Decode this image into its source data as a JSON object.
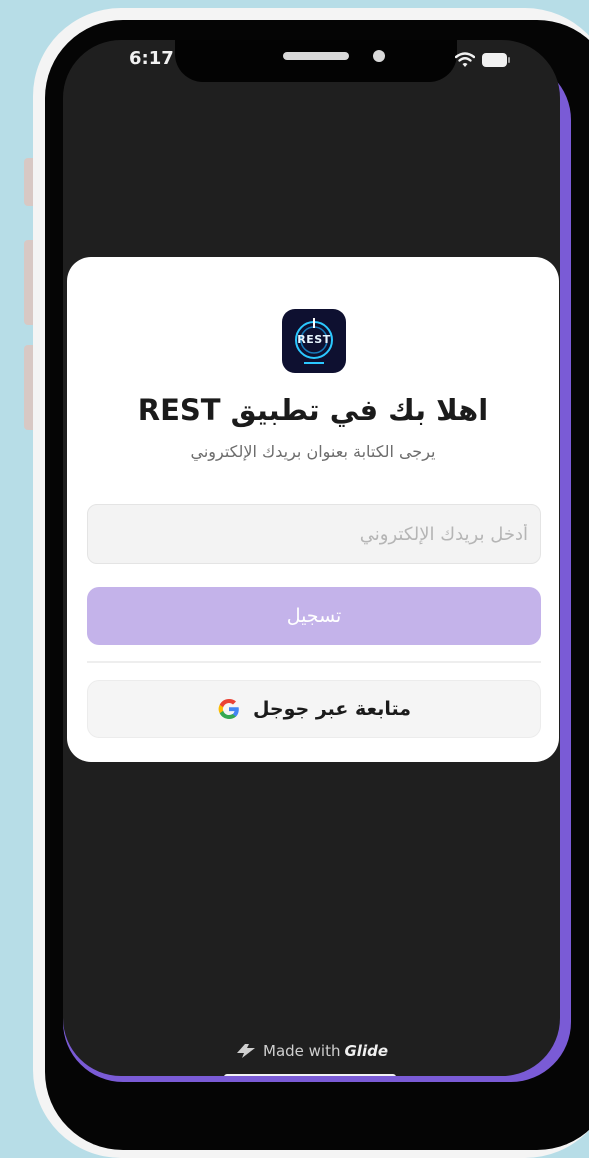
{
  "status_bar": {
    "time": "6:17"
  },
  "card": {
    "logo": "REST",
    "title": "اهلا بك في تطبيق REST",
    "subtitle": "يرجى الكتابة بعنوان بريدك الإلكتروني",
    "email_placeholder": "أدخل بريدك الإلكتروني",
    "email_value": "",
    "register_label": "تسجيل",
    "google_label": "متابعة عبر جوجل"
  },
  "footer": {
    "made_with": "Made with",
    "brand": "Glide"
  },
  "colors": {
    "background": "#b7dde7",
    "screen": "#1f1f1f",
    "accent": "#c4b3ea",
    "rim": "#7a5bd6"
  }
}
